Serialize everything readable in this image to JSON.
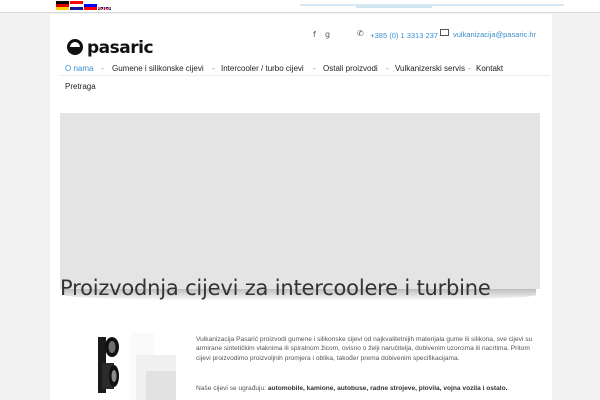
{
  "languages": [
    {
      "name": "German",
      "icon": "de-flag-icon"
    },
    {
      "name": "Croatian",
      "icon": "hr-flag-icon"
    },
    {
      "name": "Slovenian",
      "icon": "si-flag-icon"
    },
    {
      "name": "English",
      "icon": "gb-flag-icon"
    }
  ],
  "header": {
    "logo_text": "pasaric",
    "social": {
      "facebook": "f",
      "google": "g"
    },
    "phone": "+385 (0) 1 3313 237",
    "email": "vulkanizacija@pasaric.hr",
    "accent_color": "#3b8fd0"
  },
  "nav": {
    "items": [
      {
        "label": "O nama"
      },
      {
        "label": "Gumene i silikonske cijevi"
      },
      {
        "label": "Intercooler / turbo cijevi"
      },
      {
        "label": "Ostali proizvodi"
      },
      {
        "label": "Vulkanizerski servis"
      },
      {
        "label": "Kontakt"
      },
      {
        "label": "Pretraga"
      }
    ],
    "separator": "-",
    "active_index": 0
  },
  "main": {
    "heading": "Proizvodnja cijevi za intercoolere i turbine",
    "intro": "Vulkanizacija Pasarić proizvodi gumene i silikonske cijevi od najkvalitetnijih materijala gume ili silikona, sve cijevi su armirane sintetičkim vlaknima ili spiralnom žicom, ovisno o želji naručitelja, dobivenim uzorcima ili nacrtima. Pritom cijevi proizvodimo proizvoljnih promjera i oblika, također prema dobivenim specifikacijama.",
    "usage_prefix": "Naše cijevi se ugrađuju: ",
    "usage_items": "automobile, kamione, autobuse, radne strojeve, plovila, vojna vozila i ostalo."
  }
}
